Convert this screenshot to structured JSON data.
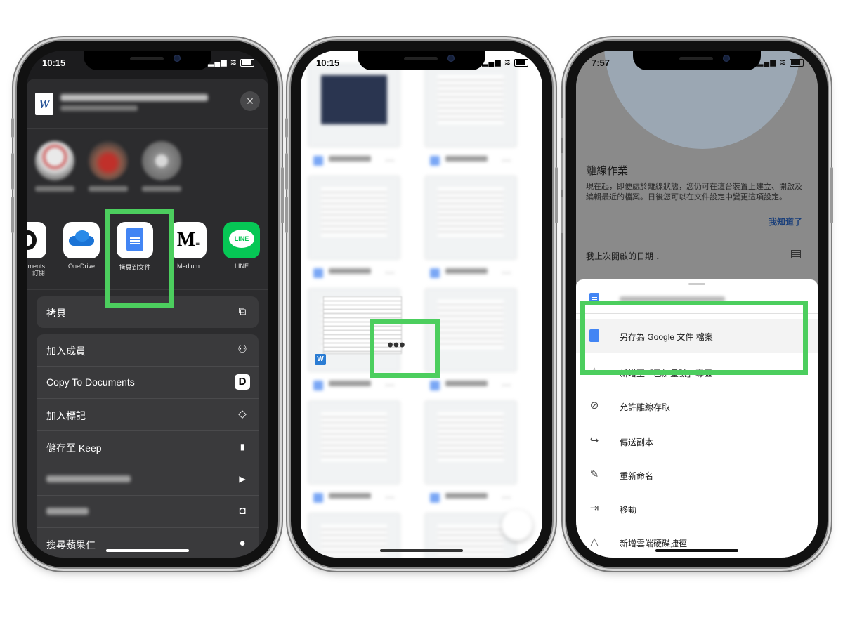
{
  "phone1": {
    "status_time": "10:15",
    "close_symbol": "×",
    "apps": [
      {
        "label": "uments\n訂閱"
      },
      {
        "label": "OneDrive"
      },
      {
        "label": "拷貝到文件"
      },
      {
        "label": "Medium"
      },
      {
        "label": "LINE"
      }
    ],
    "medium_logo": "M",
    "line_logo": "LINE",
    "word_logo": "W",
    "copy_row": "拷貝",
    "actions": [
      {
        "label": "加入成員"
      },
      {
        "label": "Copy To Documents"
      },
      {
        "label": "加入標記"
      },
      {
        "label": "儲存至 Keep"
      },
      {
        "label": ""
      },
      {
        "label": ""
      },
      {
        "label": "搜尋蘋果仁"
      }
    ]
  },
  "phone2": {
    "status_time": "10:15",
    "more_symbol": "•••",
    "word_chip": "W"
  },
  "phone3": {
    "status_time": "7:57",
    "offline_title": "離線作業",
    "offline_body": "現在起，即便處於離線狀態，您仍可在這台裝置上建立、開啟及編輯最近的檔案。日後您可以在文件設定中變更這項設定。",
    "got_it": "我知道了",
    "sort_label": "我上次開啟的日期 ↓",
    "menu": [
      {
        "label": "另存為 Google 文件 檔案"
      },
      {
        "label": "新增至「已加星號」專區"
      },
      {
        "label": "允許離線存取"
      },
      {
        "label": "傳送副本"
      },
      {
        "label": "重新命名"
      },
      {
        "label": "移動"
      },
      {
        "label": "新增雲端硬碟捷徑"
      }
    ]
  },
  "colors": {
    "highlight": "#4cce5e",
    "ios_dark_sheet": "#2c2c2e",
    "google_blue": "#4285f4",
    "line_green": "#06c755"
  }
}
